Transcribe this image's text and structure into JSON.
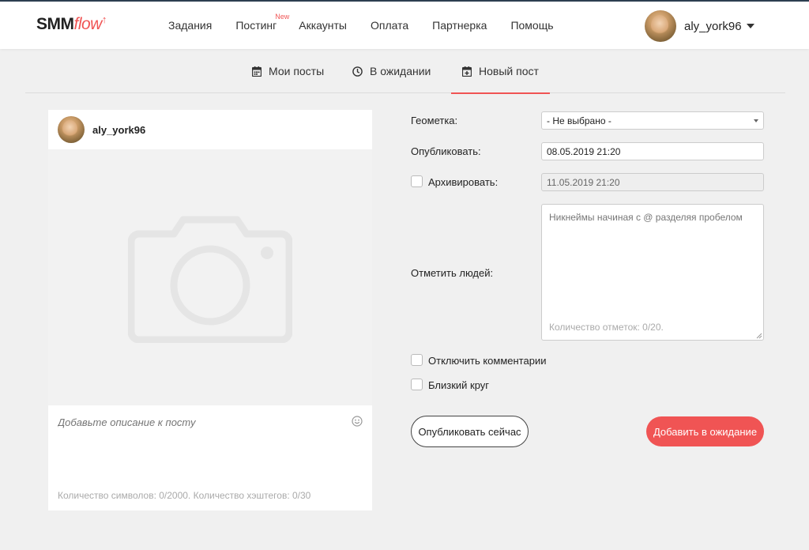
{
  "header": {
    "logo_main": "SMM",
    "logo_accent": "flow",
    "nav": [
      {
        "label": "Задания"
      },
      {
        "label": "Постинг",
        "badge": "New"
      },
      {
        "label": "Аккаунты"
      },
      {
        "label": "Оплата"
      },
      {
        "label": "Партнерка"
      },
      {
        "label": "Помощь"
      }
    ],
    "user_name": "aly_york96"
  },
  "tabs": [
    {
      "label": "Мои посты",
      "icon": "calendar-icon"
    },
    {
      "label": "В ожидании",
      "icon": "clock-icon"
    },
    {
      "label": "Новый пост",
      "icon": "calendar-plus-icon",
      "active": true
    }
  ],
  "post": {
    "user_name": "aly_york96",
    "photo_icon": "camera-icon",
    "description_placeholder": "Добавьте описание к посту",
    "counter": "Количество символов: 0/2000. Количество хэштегов: 0/30"
  },
  "form": {
    "geo_label": "Геометка:",
    "geo_value": "- Не выбрано -",
    "publish_label": "Опубликовать:",
    "publish_value": "08.05.2019 21:20",
    "archive_label": "Архивировать:",
    "archive_value": "11.05.2019 21:20",
    "tag_label": "Отметить людей:",
    "tag_placeholder": "Никнеймы начиная с @ разделяя пробелом",
    "tag_counter": "Количество отметок: 0/20.",
    "disable_comments_label": "Отключить комментарии",
    "close_friends_label": "Близкий круг",
    "publish_now_button": "Опубликовать сейчас",
    "add_pending_button": "Добавить в ожидание"
  },
  "colors": {
    "accent": "#f05454",
    "background": "#f0f0f0"
  }
}
